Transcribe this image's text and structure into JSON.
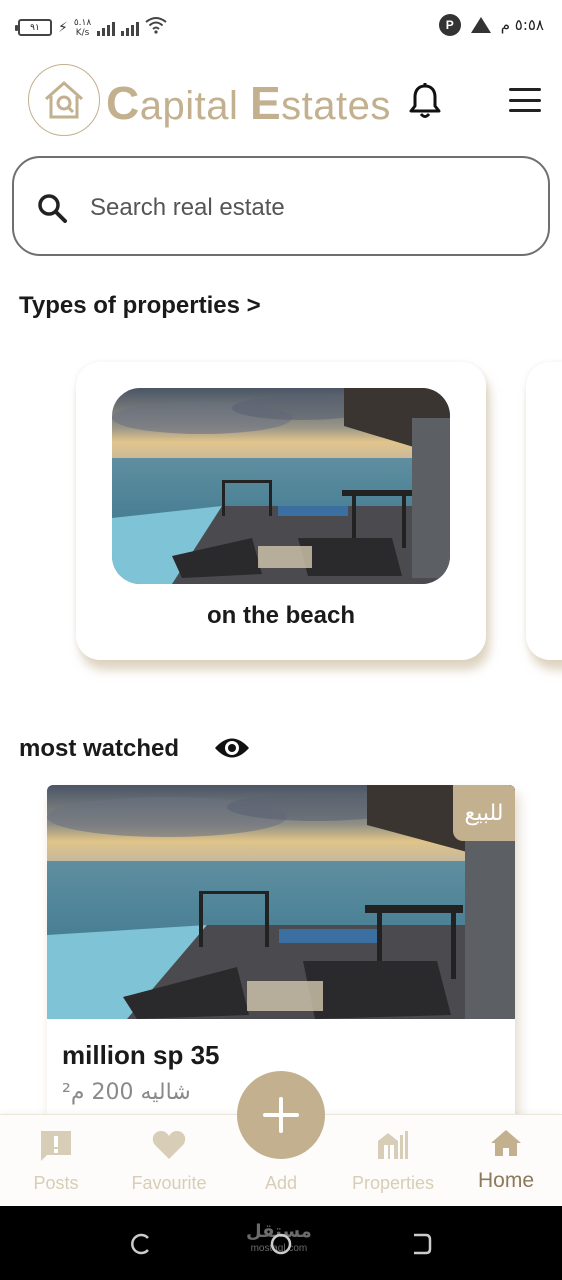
{
  "status_bar": {
    "battery": "٩١",
    "net_speed_value": "٥.١٨",
    "net_speed_unit": "K/s",
    "time": "٥:٥٨ م"
  },
  "header": {
    "brand_first_initial": "C",
    "brand_first_rest": "apital ",
    "brand_second_initial": "E",
    "brand_second_rest": "states",
    "icons": [
      "logo-house-icon",
      "bell-icon",
      "hamburger-menu-icon"
    ]
  },
  "search": {
    "placeholder": "Search real estate"
  },
  "types_section": {
    "title": "Types of properties >",
    "cards": [
      {
        "label": "on the beach"
      }
    ]
  },
  "most_watched": {
    "title": "most watched",
    "listing": {
      "badge": "للبيع",
      "price": "million sp 35",
      "subinfo": "شاليه 200 م²"
    }
  },
  "bottom_nav": {
    "items": [
      {
        "label": "Posts",
        "icon": "alert-message-icon"
      },
      {
        "label": "Favourite",
        "icon": "heart-icon"
      },
      {
        "label": "Add",
        "icon": "plus-icon"
      },
      {
        "label": "Properties",
        "icon": "buildings-icon"
      },
      {
        "label": "Home",
        "icon": "home-icon",
        "active": true
      }
    ]
  },
  "watermark": {
    "text": "مستقل",
    "url": "mostaql.com"
  },
  "colors": {
    "accent": "#c2b08e",
    "accent_light": "#d8cdb6",
    "active": "#8c7a5a",
    "text": "#1a1a1a"
  }
}
